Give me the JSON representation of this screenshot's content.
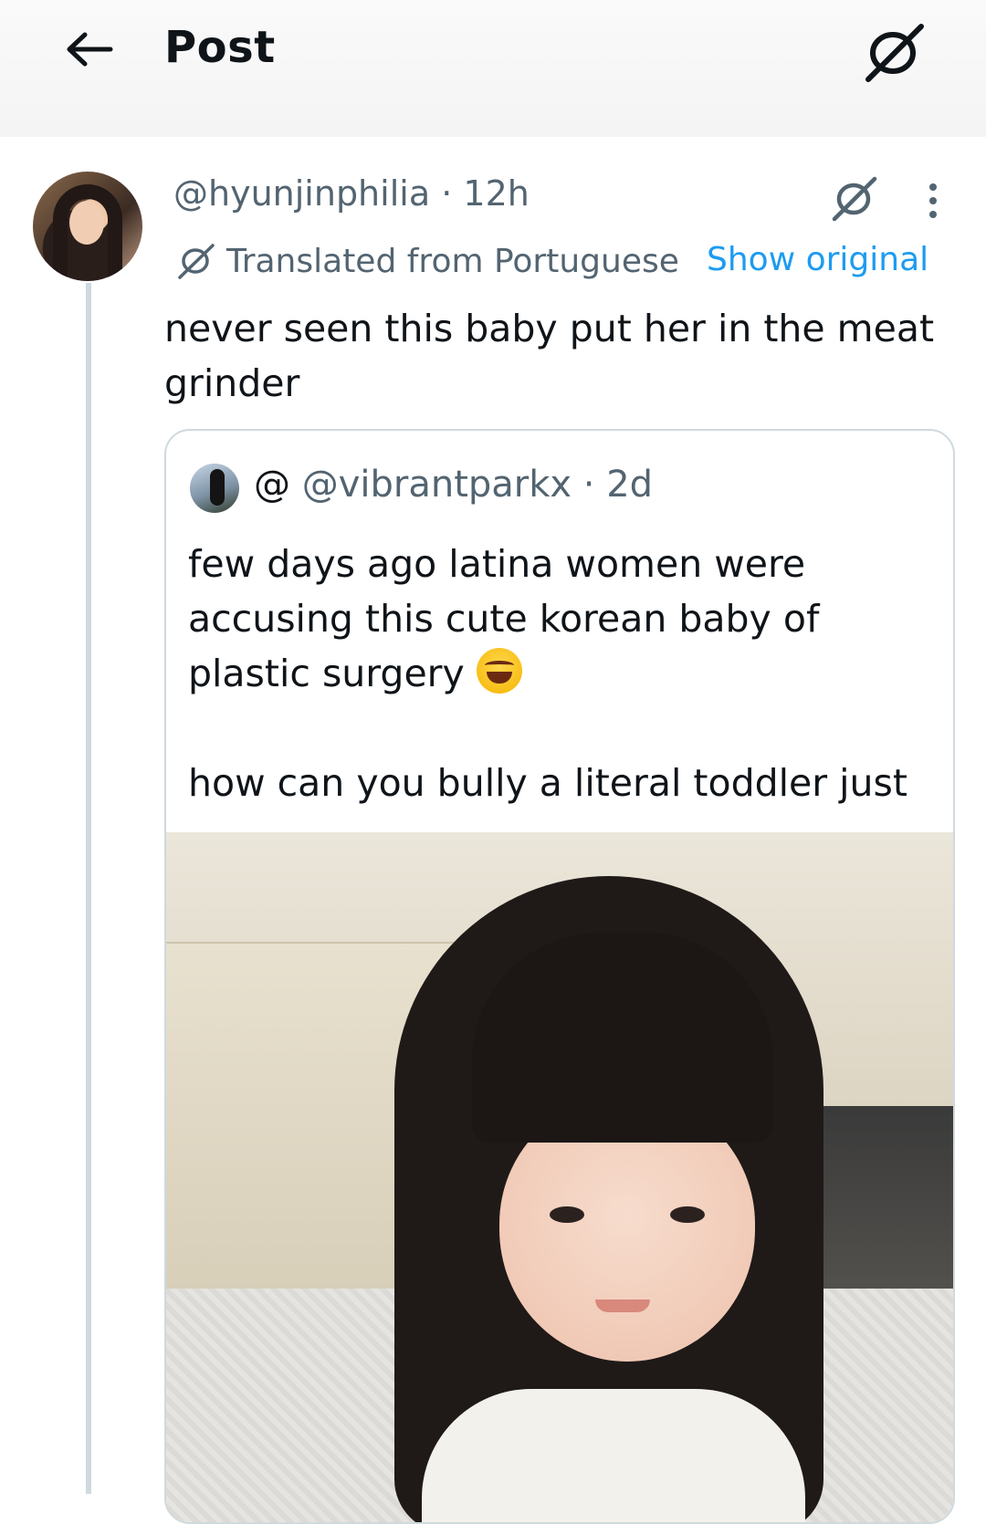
{
  "header": {
    "title": "Post",
    "back_icon": "arrow-left-icon",
    "grok_icon": "grok-icon"
  },
  "post": {
    "handle": "@hyunjinphilia",
    "separator": "·",
    "time": "12h",
    "translation_note": "Translated from Portuguese",
    "show_original": "Show original",
    "text": "never seen this baby put her in the meat grinder"
  },
  "quote": {
    "display_name": "@",
    "handle": "@vibrantparkx",
    "separator": "·",
    "time": "2d",
    "line1": "few days ago latina women were accusing this cute korean baby of plastic surgery",
    "line2": "how can you bully a literal toddler just ..."
  },
  "colors": {
    "text": "#0f1419",
    "secondary": "#536471",
    "link": "#1d9bf0",
    "border": "#cfd9de"
  }
}
